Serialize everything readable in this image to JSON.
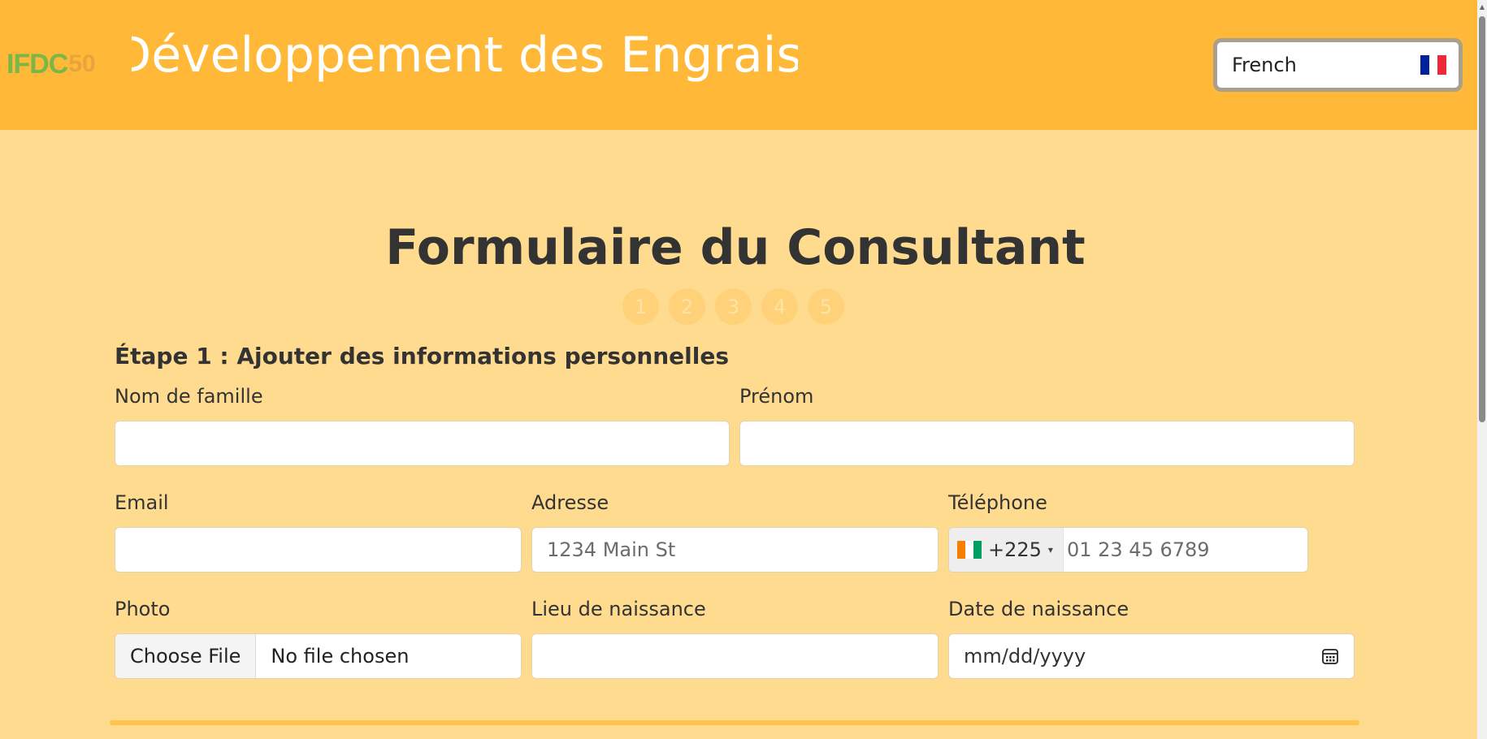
{
  "header": {
    "logo_text": "IFDC",
    "logo_number": "50",
    "site_title": "Développement des Engrais",
    "language": "French",
    "language_flag_colors": [
      "#002395",
      "#ffffff",
      "#ed2939"
    ],
    "background_color": "#ffb838"
  },
  "form": {
    "title": "Formulaire du Consultant",
    "steps": [
      "1",
      "2",
      "3",
      "4",
      "5"
    ],
    "step_title": "Étape 1 : Ajouter des informations personnelles",
    "fields": {
      "last_name": {
        "label": "Nom de famille",
        "value": ""
      },
      "first_name": {
        "label": "Prénom",
        "value": ""
      },
      "email": {
        "label": "Email",
        "value": ""
      },
      "address": {
        "label": "Adresse",
        "placeholder": "1234 Main St"
      },
      "phone": {
        "label": "Téléphone",
        "dial_code": "+225",
        "placeholder": "01 23 45 6789",
        "flag_colors": [
          "#f77f00",
          "#ffffff",
          "#009e60"
        ]
      },
      "photo": {
        "label": "Photo",
        "button": "Choose File",
        "status": "No file chosen"
      },
      "birthplace": {
        "label": "Lieu de naissance",
        "value": ""
      },
      "birthdate": {
        "label": "Date de naissance",
        "placeholder": "mm/dd/yyyy",
        "icon": "calendar-icon"
      }
    }
  },
  "colors": {
    "page_background": "#ffdb8f",
    "accent": "#ffb838"
  }
}
